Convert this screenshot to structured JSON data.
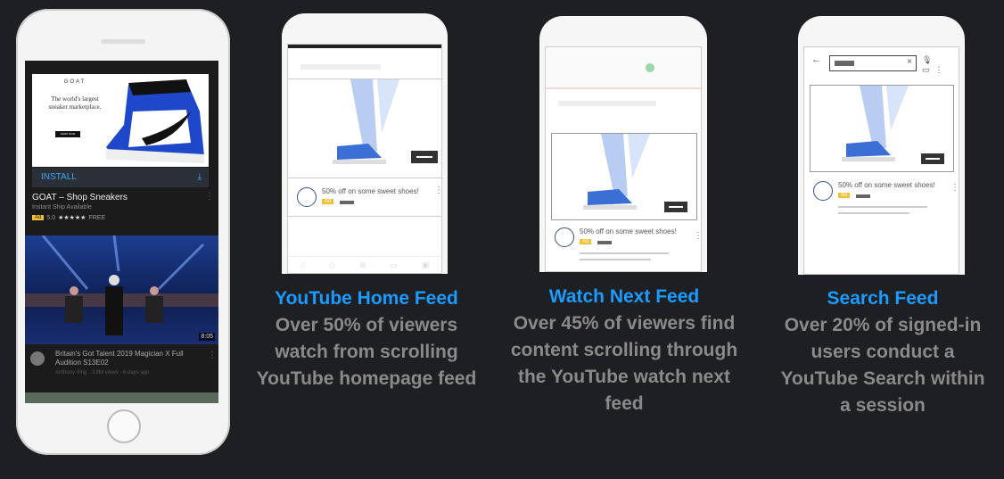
{
  "phone1": {
    "brand": "GOAT",
    "tagline": "The world's largest sneaker marketplace.",
    "shop_now": "SHOP NOW",
    "install_label": "INSTALL",
    "download_icon": "download-icon",
    "app_title": "GOAT – Shop Sneakers",
    "app_subtitle": "Instant Ship Available",
    "ad_badge": "Ad",
    "rating": "5.0",
    "stars": "★★★★★",
    "price": "FREE",
    "video_title": "Britain's Got Talent 2019 Magician X Full Audition S13E02",
    "video_meta": "Anthony Ying · 3.8M views · 6 days ago",
    "duration": "8:05"
  },
  "ad_card": {
    "text": "50% off on some sweet shoes!",
    "badge": "Ad"
  },
  "colors": {
    "accent": "#1a9bff",
    "caption": "#8a8a8a",
    "background": "#1e1f22",
    "ad_yellow": "#f3c033"
  },
  "captions": [
    {
      "heading": "YouTube Home Feed",
      "body": "Over 50% of viewers watch from scrolling YouTube homepage feed"
    },
    {
      "heading": "Watch Next Feed",
      "body": "Over 45% of viewers find content scrolling through the YouTube watch next feed"
    },
    {
      "heading": "Search Feed",
      "body": "Over 20% of signed-in users conduct a YouTube Search within a session"
    }
  ]
}
